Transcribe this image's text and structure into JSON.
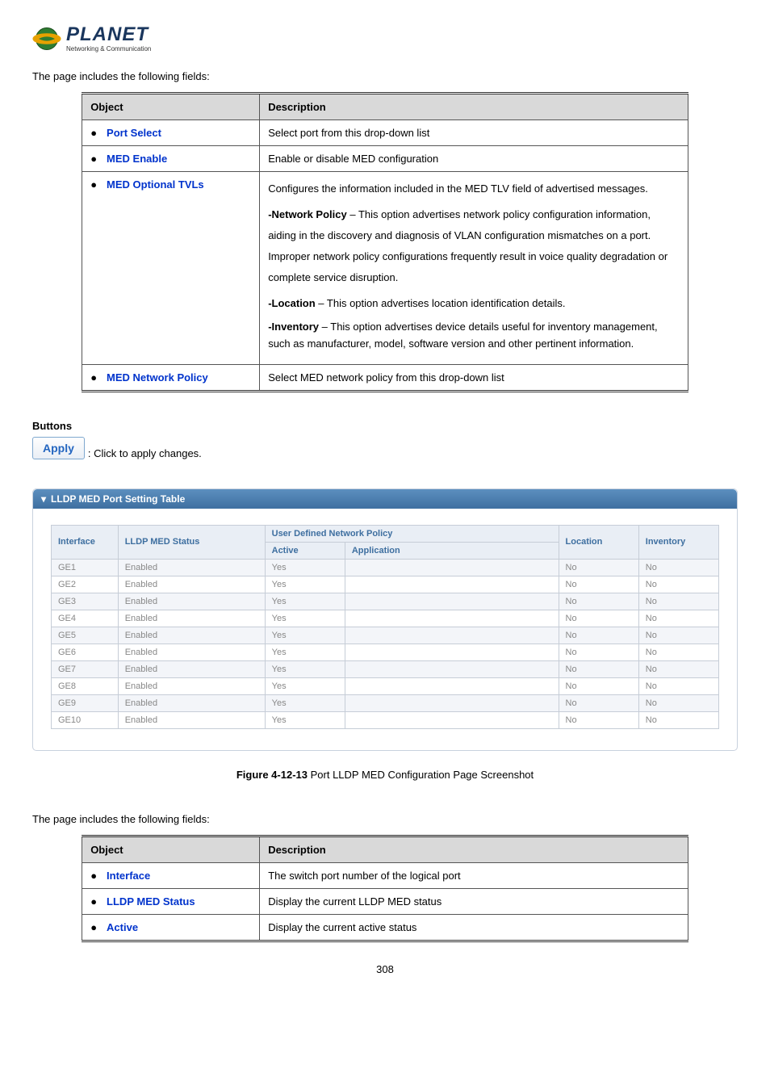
{
  "logo": {
    "brand": "PLANET",
    "tagline": "Networking & Communication"
  },
  "intro1": "The page includes the following fields:",
  "table1": {
    "headers": {
      "object": "Object",
      "description": "Description"
    },
    "rows": [
      {
        "object": "Port Select",
        "description_simple": "Select port from this drop-down list"
      },
      {
        "object": "MED Enable",
        "description_simple": "Enable or disable MED configuration"
      },
      {
        "object": "MED Optional TVLs",
        "desc_intro": "Configures the information included in the MED TLV field of advertised messages.",
        "desc_np_label": "-Network Policy",
        "desc_np_text": " – This option advertises network policy configuration information, aiding in the discovery and diagnosis of VLAN configuration mismatches on a port. Improper network policy configurations frequently result in voice quality degradation or complete service disruption.",
        "desc_loc_label": "-Location",
        "desc_loc_text": " – This option advertises location identification details.",
        "desc_inv_label": "-Inventory",
        "desc_inv_text": " – This option advertises device details useful for inventory management, such as manufacturer, model, software version and other pertinent information."
      },
      {
        "object": "MED Network Policy",
        "description_simple": "Select MED network policy from this drop-down list"
      }
    ]
  },
  "buttons_label": "Buttons",
  "apply_label": "Apply",
  "apply_desc": ": Click to apply changes.",
  "panel_title": "LLDP MED Port Setting Table",
  "grid": {
    "headers": {
      "interface": "Interface",
      "status": "LLDP MED Status",
      "udnp": "User Defined Network Policy",
      "active": "Active",
      "application": "Application",
      "location": "Location",
      "inventory": "Inventory"
    },
    "rows": [
      {
        "interface": "GE1",
        "status": "Enabled",
        "active": "Yes",
        "application": "",
        "location": "No",
        "inventory": "No"
      },
      {
        "interface": "GE2",
        "status": "Enabled",
        "active": "Yes",
        "application": "",
        "location": "No",
        "inventory": "No"
      },
      {
        "interface": "GE3",
        "status": "Enabled",
        "active": "Yes",
        "application": "",
        "location": "No",
        "inventory": "No"
      },
      {
        "interface": "GE4",
        "status": "Enabled",
        "active": "Yes",
        "application": "",
        "location": "No",
        "inventory": "No"
      },
      {
        "interface": "GE5",
        "status": "Enabled",
        "active": "Yes",
        "application": "",
        "location": "No",
        "inventory": "No"
      },
      {
        "interface": "GE6",
        "status": "Enabled",
        "active": "Yes",
        "application": "",
        "location": "No",
        "inventory": "No"
      },
      {
        "interface": "GE7",
        "status": "Enabled",
        "active": "Yes",
        "application": "",
        "location": "No",
        "inventory": "No"
      },
      {
        "interface": "GE8",
        "status": "Enabled",
        "active": "Yes",
        "application": "",
        "location": "No",
        "inventory": "No"
      },
      {
        "interface": "GE9",
        "status": "Enabled",
        "active": "Yes",
        "application": "",
        "location": "No",
        "inventory": "No"
      },
      {
        "interface": "GE10",
        "status": "Enabled",
        "active": "Yes",
        "application": "",
        "location": "No",
        "inventory": "No"
      }
    ]
  },
  "figure_label": "Figure 4-12-13",
  "figure_text": " Port LLDP MED Configuration Page Screenshot",
  "intro2": "The page includes the following fields:",
  "table2": {
    "headers": {
      "object": "Object",
      "description": "Description"
    },
    "rows": [
      {
        "object": "Interface",
        "description": "The switch port number of the logical port"
      },
      {
        "object": "LLDP MED Status",
        "description": "Display the current LLDP MED status"
      },
      {
        "object": "Active",
        "description": "Display the current active status"
      }
    ]
  },
  "page_number": "308"
}
